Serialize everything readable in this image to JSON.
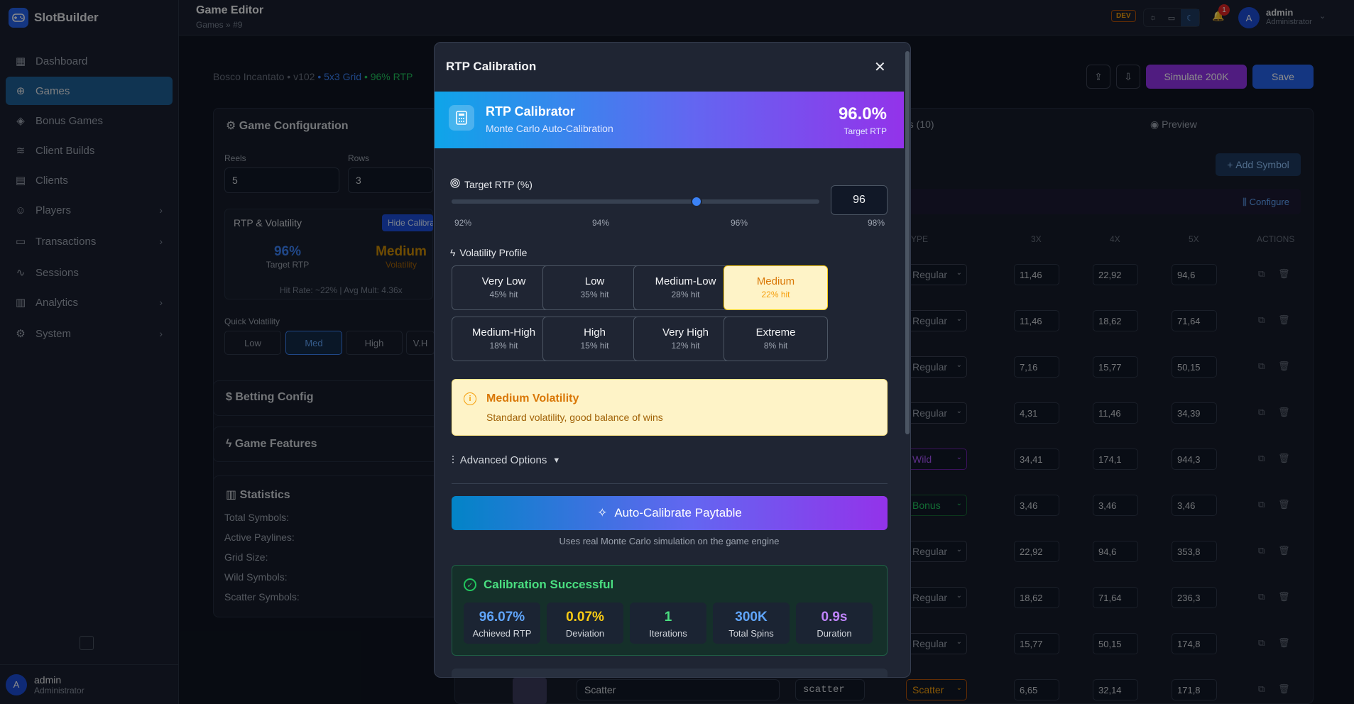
{
  "app": {
    "name": "SlotBuilder"
  },
  "sidebar": {
    "items": [
      {
        "label": "Dashboard",
        "icon": "dashboard-icon"
      },
      {
        "label": "Games",
        "icon": "gamepad-icon",
        "active": true
      },
      {
        "label": "Bonus Games",
        "icon": "puzzle-icon"
      },
      {
        "label": "Client Builds",
        "icon": "layers-icon"
      },
      {
        "label": "Clients",
        "icon": "building-icon"
      },
      {
        "label": "Players",
        "icon": "users-icon",
        "expandable": true
      },
      {
        "label": "Transactions",
        "icon": "receipt-icon",
        "expandable": true
      },
      {
        "label": "Sessions",
        "icon": "activity-icon"
      },
      {
        "label": "Analytics",
        "icon": "bar-chart-icon",
        "expandable": true
      },
      {
        "label": "System",
        "icon": "gear-icon",
        "expandable": true
      }
    ],
    "user": {
      "initial": "A",
      "name": "admin",
      "role": "Administrator"
    }
  },
  "topbar": {
    "title": "Game Editor",
    "breadcrumb": [
      "Games",
      "»",
      "#9"
    ],
    "env_badge": "DEV",
    "notifications": "1",
    "user": {
      "initial": "A",
      "name": "admin",
      "role": "Administrator"
    }
  },
  "game": {
    "name": "Bosco Incantato",
    "version": "• v102",
    "grid": "• 5x3 Grid",
    "rtp": "• 96% RTP"
  },
  "header_actions": {
    "simulate": "Simulate 200K",
    "save": "Save"
  },
  "config": {
    "title": "Game Configuration",
    "reels_label": "Reels",
    "reels": "5",
    "rows_label": "Rows",
    "rows": "3",
    "rtp_vol_title": "RTP & Volatility",
    "hide_calibrator": "Hide Calibra",
    "rtp_value": "96%",
    "rtp_label": "Target RTP",
    "vol_value": "Medium",
    "vol_label": "Volatility",
    "hit_info": "Hit Rate: ~22% | Avg Mult: 4.36x",
    "quick_label": "Quick Volatility",
    "quick": [
      "Low",
      "Med",
      "High",
      "V.H"
    ],
    "betting": "Betting Config",
    "features": "Game Features",
    "stats_title": "Statistics",
    "stats": [
      "Total Symbols:",
      "Active Paylines:",
      "Grid Size:",
      "Wild Symbols:",
      "Scatter Symbols:"
    ]
  },
  "symbols": {
    "tab": "es (10)",
    "preview_tab": "Preview",
    "add": "Add Symbol",
    "configure": "Configure",
    "headers": [
      "YPE",
      "3X",
      "4X",
      "5X",
      "ACTIONS"
    ],
    "rows": [
      {
        "type": "Regular",
        "c3": "11,46",
        "c4": "22,92",
        "c5": "94,6"
      },
      {
        "type": "Regular",
        "c3": "11,46",
        "c4": "18,62",
        "c5": "71,64"
      },
      {
        "type": "Regular",
        "c3": "7,16",
        "c4": "15,77",
        "c5": "50,15"
      },
      {
        "type": "Regular",
        "c3": "4,31",
        "c4": "11,46",
        "c5": "34,39"
      },
      {
        "type": "Wild",
        "c3": "34,41",
        "c4": "174,1",
        "c5": "944,3"
      },
      {
        "type": "Bonus",
        "c3": "3,46",
        "c4": "3,46",
        "c5": "3,46"
      },
      {
        "type": "Regular",
        "c3": "22,92",
        "c4": "94,6",
        "c5": "353,8"
      },
      {
        "type": "Regular",
        "c3": "18,62",
        "c4": "71,64",
        "c5": "236,3"
      },
      {
        "type": "Regular",
        "c3": "15,77",
        "c4": "50,15",
        "c5": "174,8"
      },
      {
        "type": "Scatter",
        "c3": "6,65",
        "c4": "32,14",
        "c5": "171,8",
        "name": "Scatter",
        "id": "scatter"
      }
    ]
  },
  "modal": {
    "title": "RTP Calibration",
    "hero": {
      "title": "RTP Calibrator",
      "subtitle": "Monte Carlo Auto-Calibration",
      "value": "96.0%",
      "value_label": "Target RTP"
    },
    "target_label": "Target RTP (%)",
    "target_value": "96",
    "slider": {
      "min": 92,
      "max": 98,
      "value": 96
    },
    "ticks": [
      "92%",
      "94%",
      "96%",
      "98%"
    ],
    "volatility_label": "Volatility Profile",
    "profiles": [
      {
        "name": "Very Low",
        "hit": "45% hit"
      },
      {
        "name": "Low",
        "hit": "35% hit"
      },
      {
        "name": "Medium-Low",
        "hit": "28% hit"
      },
      {
        "name": "Medium",
        "hit": "22% hit",
        "selected": true
      },
      {
        "name": "Medium-High",
        "hit": "18% hit"
      },
      {
        "name": "High",
        "hit": "15% hit"
      },
      {
        "name": "Very High",
        "hit": "12% hit"
      },
      {
        "name": "Extreme",
        "hit": "8% hit"
      }
    ],
    "info": {
      "title": "Medium Volatility",
      "text": "Standard volatility, good balance of wins"
    },
    "advanced": "Advanced Options",
    "calibrate_button": "Auto-Calibrate Paytable",
    "calibrate_note": "Uses real Monte Carlo simulation on the game engine",
    "result": {
      "title": "Calibration Successful",
      "stats": [
        {
          "value": "96.07%",
          "label": "Achieved RTP",
          "color": "#60a5fa"
        },
        {
          "value": "0.07%",
          "label": "Deviation",
          "color": "#facc15"
        },
        {
          "value": "1",
          "label": "Iterations",
          "color": "#4ade80"
        },
        {
          "value": "300K",
          "label": "Total Spins",
          "color": "#60a5fa"
        },
        {
          "value": "0.9s",
          "label": "Duration",
          "color": "#c084fc"
        }
      ]
    }
  }
}
